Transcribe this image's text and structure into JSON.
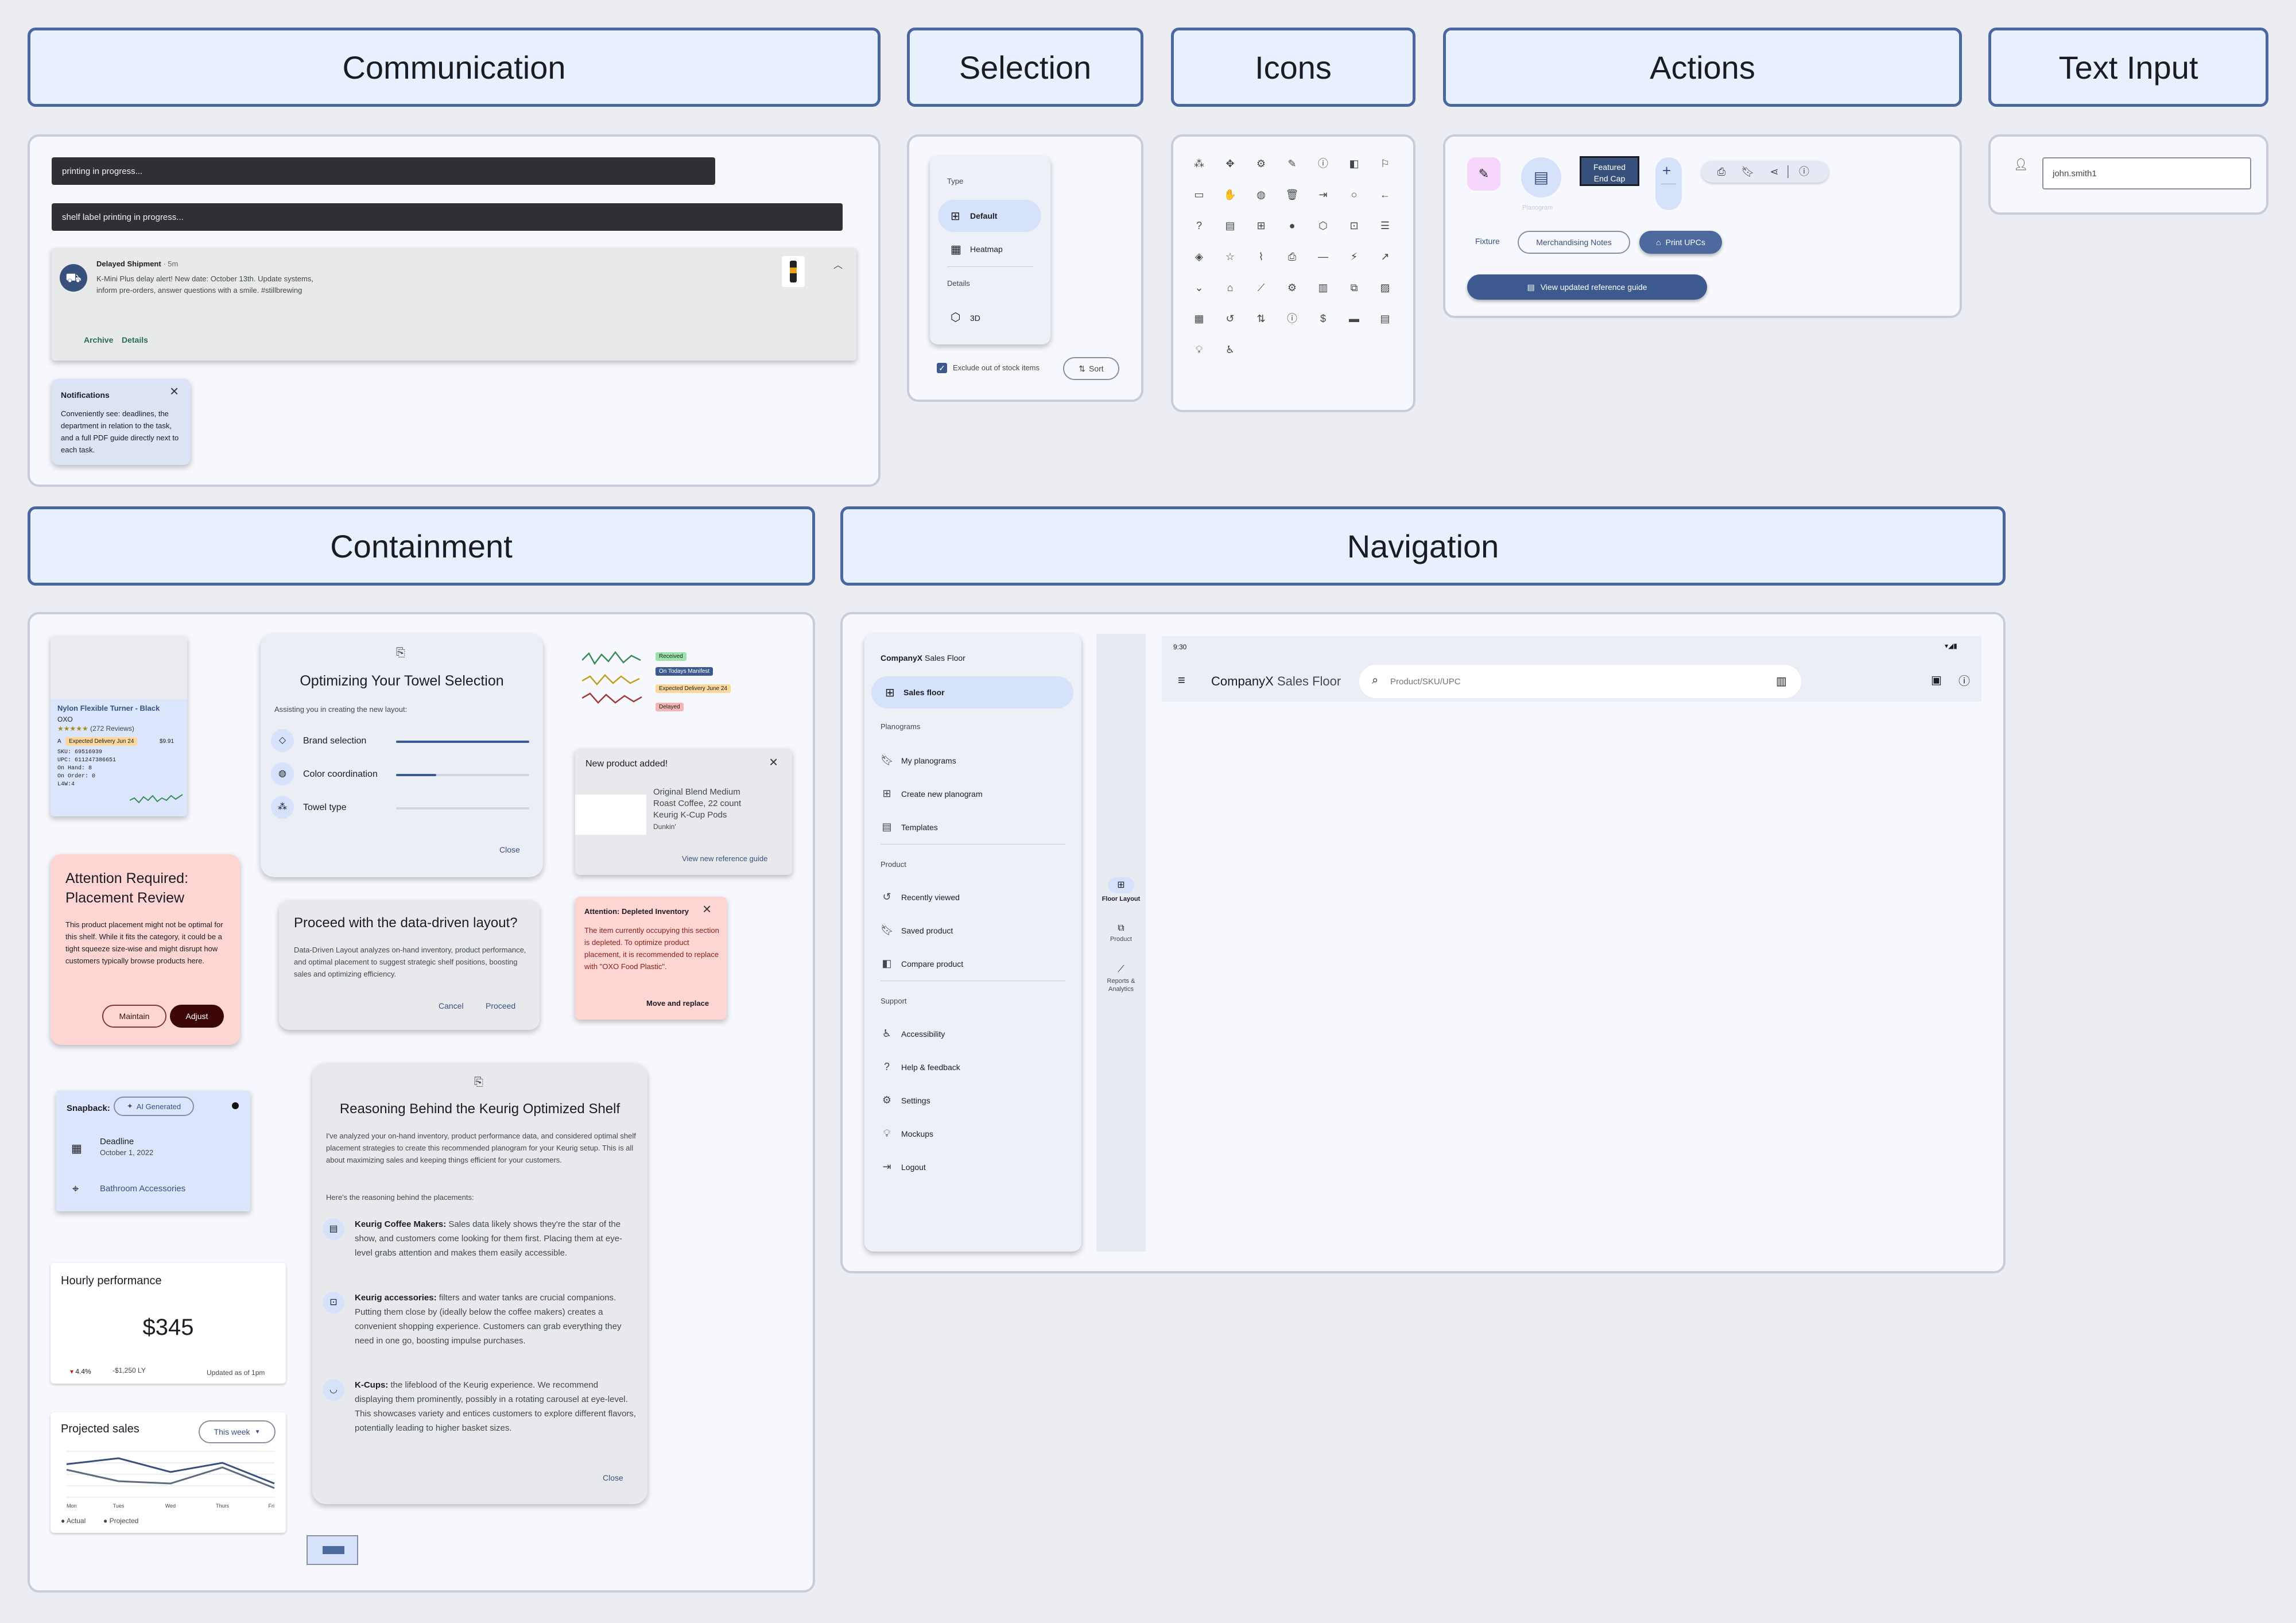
{
  "headers": {
    "communication": "Communication",
    "selection": "Selection",
    "icons": "Icons",
    "actions": "Actions",
    "text_input": "Text Input",
    "containment": "Containment",
    "navigation": "Navigation"
  },
  "communication": {
    "snack1": "printing in progress...",
    "snack2": "shelf label printing in progress...",
    "notif_title": "Delayed Shipment",
    "notif_time": " · 5m",
    "notif_body1": "K-Mini Plus delay alert! New date: October 13th. Update systems,",
    "notif_body2": "inform pre-orders, answer questions with a smile. #stillbrewing",
    "archive": "Archive",
    "details": "Details",
    "tooltip_title": "Notifications",
    "tooltip_body": "Conveniently see: deadlines, the department in relation to the task, and a full PDF guide directly next to each task."
  },
  "selection": {
    "type": "Type",
    "default": "Default",
    "heatmap": "Heatmap",
    "details": "Details",
    "three_d": "3D",
    "exclude": "Exclude out of stock items",
    "sort": "Sort"
  },
  "actions": {
    "featured": "Featured",
    "end_cap": "End Cap",
    "planogram": "Planogram",
    "fixture": "Fixture",
    "merch": "Merchandising Notes",
    "print_upcs": "Print UPCs",
    "view_guide": "View updated reference guide"
  },
  "text_input": {
    "value": "john.smith1"
  },
  "containment": {
    "product": {
      "name": "Nylon Flexible Turner - Black",
      "brand": "OXO",
      "reviews": "(272 Reviews)",
      "aisle": "A",
      "delivery": "Expected Delivery Jun 24",
      "price": "$9.91",
      "sku": "SKU: 69516939",
      "upc": "UPC: 611247386651",
      "onhand": "On Hand: 8",
      "onorder": "On Order: 0",
      "lw": "L4W:4"
    },
    "towel": {
      "title": "Optimizing Your Towel Selection",
      "sub": "Assisting you in creating the new layout:",
      "r1": "Brand selection",
      "r2": "Color coordination",
      "r3": "Towel type",
      "close": "Close"
    },
    "tags": {
      "received": "Received",
      "manifest": "On Todays Manifest",
      "expected": "Expected Delivery June 24",
      "delayed": "Delayed"
    },
    "newprod": {
      "title": "New product added!",
      "line1": "Original Blend Medium",
      "line2": "Roast Coffee, 22 count",
      "line3": "Keurig K-Cup Pods",
      "line4": "Dunkin'",
      "link": "View new reference guide"
    },
    "attention": {
      "title1": "Attention Required:",
      "title2": "Placement Review",
      "body": "This product placement might not be optimal for this shelf. While it fits the category, it could be a tight squeeze size-wise and might disrupt how customers typically browse products here.",
      "maintain": "Maintain",
      "adjust": "Adjust"
    },
    "proceed": {
      "title": "Proceed with the data-driven layout?",
      "body": "Data-Driven Layout analyzes on-hand inventory, product performance, and optimal placement to suggest strategic shelf positions, boosting sales and optimizing efficiency.",
      "cancel": "Cancel",
      "proceed": "Proceed"
    },
    "depleted": {
      "title": "Attention: Depleted Inventory",
      "body": "The item currently occupying this section is depleted. To optimize product placement, it is recommended to replace with \"OXO Food Plastic\".",
      "action": "Move and replace"
    },
    "snapback": {
      "title": "Snapback:",
      "ai": "AI Generated",
      "deadline": "Deadline",
      "date": "October 1, 2022",
      "dept": "Bathroom Accessories"
    },
    "reasoning": {
      "title": "Reasoning Behind the Keurig Optimized Shelf",
      "intro": "I've analyzed your on-hand inventory, product performance data, and considered optimal shelf placement strategies to create this recommended planogram for your Keurig setup. This is all about maximizing sales and keeping things efficient for your customers.",
      "lead": "Here's the reasoning behind the placements:",
      "h1": "Keurig Coffee Makers:",
      "b1": " Sales data likely shows they're the star of the show, and customers come looking for them first. Placing them at eye-level grabs attention and makes them easily accessible.",
      "h2": "Keurig accessories:",
      "b2": " filters and water tanks are crucial companions. Putting them close by (ideally below the coffee makers) creates a convenient shopping experience. Customers can grab everything they need in one go, boosting impulse purchases.",
      "h3": "K-Cups:",
      "b3": " the lifeblood of the Keurig experience. We recommend displaying them prominently, possibly in a rotating carousel at eye-level. This showcases variety and entices customers to explore different flavors, potentially leading to higher basket sizes.",
      "close": "Close"
    },
    "hourly": {
      "title": "Hourly performance",
      "value": "$345",
      "delta": "4.4%",
      "ly": "-$1,250 LY",
      "updated": "Updated as of 1pm"
    },
    "projected": {
      "title": "Projected sales",
      "range": "This week",
      "actual": "Actual",
      "proj": "Projected"
    }
  },
  "chart_data": {
    "type": "line",
    "title": "Projected sales",
    "categories": [
      "Mon",
      "Tues",
      "Wed",
      "Thurs",
      "Fri"
    ],
    "series": [
      {
        "name": "Actual",
        "values": [
          0.72,
          0.85,
          0.55,
          0.75,
          0.3
        ]
      },
      {
        "name": "Projected",
        "values": [
          0.6,
          0.35,
          0.3,
          0.65,
          0.2
        ]
      }
    ]
  },
  "navigation": {
    "drawer": {
      "brand_a": "CompanyX",
      "brand_b": " Sales Floor",
      "sales_floor": "Sales floor",
      "planograms": "Planograms",
      "my": "My planograms",
      "create": "Create new planogram",
      "templates": "Templates",
      "product": "Product",
      "recent": "Recently viewed",
      "saved": "Saved product",
      "compare": "Compare product",
      "support": "Support",
      "access": "Accessibility",
      "help": "Help & feedback",
      "settings": "Settings",
      "mockups": "Mockups",
      "logout": "Logout"
    },
    "rail": {
      "floor": "Floor Layout",
      "product": "Product",
      "reports": "Reports & Analytics"
    },
    "app": {
      "time": "9:30",
      "brand_a": "CompanyX",
      "brand_b": " Sales Floor",
      "search_placeholder": "Product/SKU/UPC"
    }
  }
}
